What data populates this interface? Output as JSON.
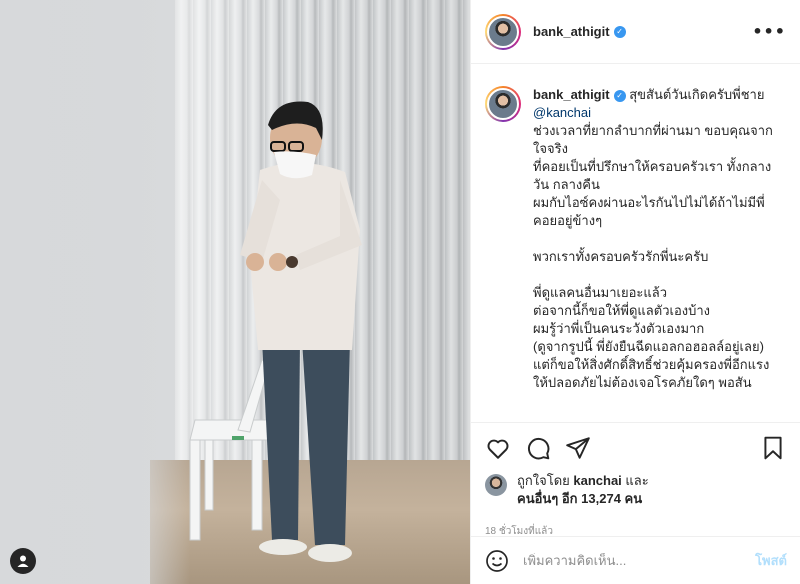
{
  "post": {
    "username": "bank_athigit",
    "more_icon": "more-horizontal-icon",
    "mention": "@kanchai",
    "caption_lines": [
      "สุขสันต์วันเกิดครับพี่ชาย",
      "ช่วงเวลาที่ยากลำบากที่ผ่านมา ขอบคุณจากใจจริง",
      "ที่คอยเป็นที่ปรึกษาให้ครอบครัวเรา ทั้งกลางวัน กลางคืน",
      "ผมกับไอซ์คงผ่านอะไรกันไปไม่ได้ถ้าไม่มีพี่คอยอยู่ข้างๆ",
      "",
      "พวกเราทั้งครอบครัวรักพี่นะครับ",
      "",
      "พี่ดูแลคนอื่นมาเยอะแล้ว",
      "ต่อจากนี้ก็ขอให้พี่ดูแลตัวเองบ้าง",
      "ผมรู้ว่าพี่เป็นคนระวังตัวเองมาก",
      "(ดูจากรูปนี้ พี่ยังยืนฉีดแอลกอฮอลล์อยู่เลย)",
      "แต่ก็ขอให้สิ่งศักดิ์สิทธิ์ช่วยคุ้มครองพี่อีกแรง",
      "ให้ปลอดภัยไม่ต้องเจอโรคภัยใดๆ พอสัน"
    ]
  },
  "actions": {
    "like_icon": "heart-icon",
    "comment_icon": "comment-icon",
    "share_icon": "share-icon",
    "save_icon": "bookmark-icon"
  },
  "likes": {
    "prefix": "ถูกใจโดย",
    "liker": "kanchai",
    "and": "และ",
    "others": "คนอื่นๆ อีก 13,274 คน"
  },
  "timestamp": "18 ชั่วโมงที่แล้ว",
  "comment": {
    "placeholder": "เพิ่มความคิดเห็น...",
    "post_label": "โพสต์",
    "emoji_icon": "smile-icon"
  },
  "colors": {
    "verified": "#3897f0",
    "link": "#00376b",
    "post_button_disabled": "#b2dffc",
    "muted": "#8e8e8e"
  }
}
